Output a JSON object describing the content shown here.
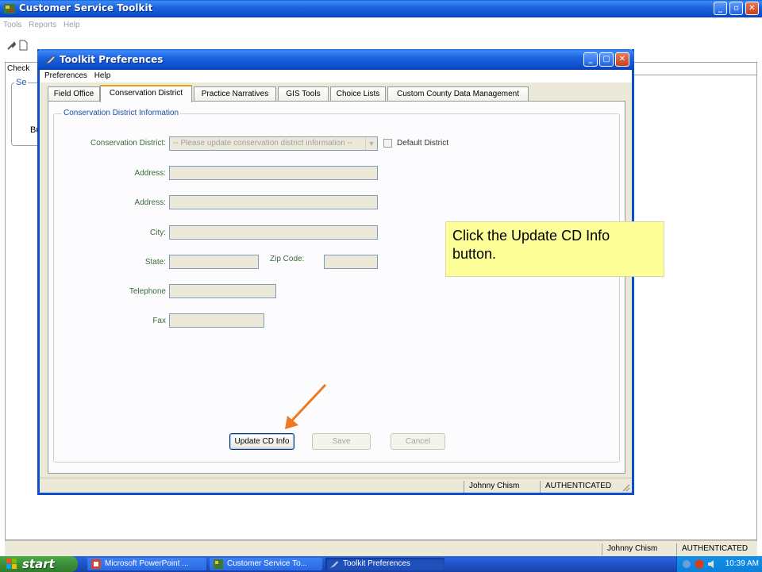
{
  "main_window": {
    "title": "Customer Service Toolkit",
    "menu": [
      "Tools",
      "Reports",
      "Help"
    ],
    "tab_label": "Check",
    "group_label": "Se",
    "partial_text": "Bu",
    "status_user": "Johnny Chism",
    "status_auth": "AUTHENTICATED",
    "window_buttons": {
      "minimize": "_",
      "maximize": "▫",
      "close": "✕"
    }
  },
  "dialog": {
    "title": "Toolkit Preferences",
    "menu": [
      "Preferences",
      "Help"
    ],
    "window_buttons": {
      "minimize": "_",
      "maximize": "▢",
      "close": "✕"
    },
    "tabs": [
      {
        "label": "Field Office",
        "active": false
      },
      {
        "label": "Conservation District",
        "active": true
      },
      {
        "label": "Practice Narratives",
        "active": false
      },
      {
        "label": "GIS Tools",
        "active": false
      },
      {
        "label": "Choice Lists",
        "active": false
      },
      {
        "label": "Custom County Data Management",
        "active": false
      }
    ],
    "group_label": "Conservation District Information",
    "fields": {
      "conservation_district": {
        "label": "Conservation District:",
        "value": "-- Please update conservation district information --"
      },
      "default_district": {
        "label": "Default District",
        "checked": false
      },
      "address1": {
        "label": "Address:",
        "value": ""
      },
      "address2": {
        "label": "Address:",
        "value": ""
      },
      "city": {
        "label": "City:",
        "value": ""
      },
      "state": {
        "label": "State:",
        "value": ""
      },
      "zip": {
        "label": "Zip Code:",
        "value": ""
      },
      "telephone": {
        "label": "Telephone",
        "value": ""
      },
      "fax": {
        "label": "Fax",
        "value": ""
      }
    },
    "buttons": {
      "update": "Update CD Info",
      "save": "Save",
      "cancel": "Cancel"
    },
    "status_user": "Johnny Chism",
    "status_auth": "AUTHENTICATED"
  },
  "callout": {
    "text": "Click the Update CD Info button.",
    "color": "#ffff99"
  },
  "arrow_color": "#f07820",
  "taskbar": {
    "start": "start",
    "items": [
      {
        "label": "Microsoft PowerPoint ...",
        "icon": "powerpoint-icon",
        "active": false
      },
      {
        "label": "Customer Service To...",
        "icon": "toolkit-icon",
        "active": false
      },
      {
        "label": "Toolkit Preferences",
        "icon": "preferences-icon",
        "active": true
      }
    ],
    "clock": "10:39 AM"
  }
}
